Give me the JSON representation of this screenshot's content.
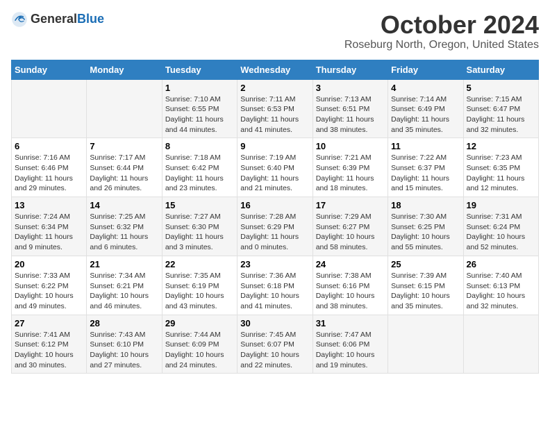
{
  "header": {
    "logo_general": "General",
    "logo_blue": "Blue",
    "month": "October 2024",
    "location": "Roseburg North, Oregon, United States"
  },
  "calendar": {
    "days_of_week": [
      "Sunday",
      "Monday",
      "Tuesday",
      "Wednesday",
      "Thursday",
      "Friday",
      "Saturday"
    ],
    "weeks": [
      [
        {
          "day": "",
          "sunrise": "",
          "sunset": "",
          "daylight": ""
        },
        {
          "day": "",
          "sunrise": "",
          "sunset": "",
          "daylight": ""
        },
        {
          "day": "1",
          "sunrise": "Sunrise: 7:10 AM",
          "sunset": "Sunset: 6:55 PM",
          "daylight": "Daylight: 11 hours and 44 minutes."
        },
        {
          "day": "2",
          "sunrise": "Sunrise: 7:11 AM",
          "sunset": "Sunset: 6:53 PM",
          "daylight": "Daylight: 11 hours and 41 minutes."
        },
        {
          "day": "3",
          "sunrise": "Sunrise: 7:13 AM",
          "sunset": "Sunset: 6:51 PM",
          "daylight": "Daylight: 11 hours and 38 minutes."
        },
        {
          "day": "4",
          "sunrise": "Sunrise: 7:14 AM",
          "sunset": "Sunset: 6:49 PM",
          "daylight": "Daylight: 11 hours and 35 minutes."
        },
        {
          "day": "5",
          "sunrise": "Sunrise: 7:15 AM",
          "sunset": "Sunset: 6:47 PM",
          "daylight": "Daylight: 11 hours and 32 minutes."
        }
      ],
      [
        {
          "day": "6",
          "sunrise": "Sunrise: 7:16 AM",
          "sunset": "Sunset: 6:46 PM",
          "daylight": "Daylight: 11 hours and 29 minutes."
        },
        {
          "day": "7",
          "sunrise": "Sunrise: 7:17 AM",
          "sunset": "Sunset: 6:44 PM",
          "daylight": "Daylight: 11 hours and 26 minutes."
        },
        {
          "day": "8",
          "sunrise": "Sunrise: 7:18 AM",
          "sunset": "Sunset: 6:42 PM",
          "daylight": "Daylight: 11 hours and 23 minutes."
        },
        {
          "day": "9",
          "sunrise": "Sunrise: 7:19 AM",
          "sunset": "Sunset: 6:40 PM",
          "daylight": "Daylight: 11 hours and 21 minutes."
        },
        {
          "day": "10",
          "sunrise": "Sunrise: 7:21 AM",
          "sunset": "Sunset: 6:39 PM",
          "daylight": "Daylight: 11 hours and 18 minutes."
        },
        {
          "day": "11",
          "sunrise": "Sunrise: 7:22 AM",
          "sunset": "Sunset: 6:37 PM",
          "daylight": "Daylight: 11 hours and 15 minutes."
        },
        {
          "day": "12",
          "sunrise": "Sunrise: 7:23 AM",
          "sunset": "Sunset: 6:35 PM",
          "daylight": "Daylight: 11 hours and 12 minutes."
        }
      ],
      [
        {
          "day": "13",
          "sunrise": "Sunrise: 7:24 AM",
          "sunset": "Sunset: 6:34 PM",
          "daylight": "Daylight: 11 hours and 9 minutes."
        },
        {
          "day": "14",
          "sunrise": "Sunrise: 7:25 AM",
          "sunset": "Sunset: 6:32 PM",
          "daylight": "Daylight: 11 hours and 6 minutes."
        },
        {
          "day": "15",
          "sunrise": "Sunrise: 7:27 AM",
          "sunset": "Sunset: 6:30 PM",
          "daylight": "Daylight: 11 hours and 3 minutes."
        },
        {
          "day": "16",
          "sunrise": "Sunrise: 7:28 AM",
          "sunset": "Sunset: 6:29 PM",
          "daylight": "Daylight: 11 hours and 0 minutes."
        },
        {
          "day": "17",
          "sunrise": "Sunrise: 7:29 AM",
          "sunset": "Sunset: 6:27 PM",
          "daylight": "Daylight: 10 hours and 58 minutes."
        },
        {
          "day": "18",
          "sunrise": "Sunrise: 7:30 AM",
          "sunset": "Sunset: 6:25 PM",
          "daylight": "Daylight: 10 hours and 55 minutes."
        },
        {
          "day": "19",
          "sunrise": "Sunrise: 7:31 AM",
          "sunset": "Sunset: 6:24 PM",
          "daylight": "Daylight: 10 hours and 52 minutes."
        }
      ],
      [
        {
          "day": "20",
          "sunrise": "Sunrise: 7:33 AM",
          "sunset": "Sunset: 6:22 PM",
          "daylight": "Daylight: 10 hours and 49 minutes."
        },
        {
          "day": "21",
          "sunrise": "Sunrise: 7:34 AM",
          "sunset": "Sunset: 6:21 PM",
          "daylight": "Daylight: 10 hours and 46 minutes."
        },
        {
          "day": "22",
          "sunrise": "Sunrise: 7:35 AM",
          "sunset": "Sunset: 6:19 PM",
          "daylight": "Daylight: 10 hours and 43 minutes."
        },
        {
          "day": "23",
          "sunrise": "Sunrise: 7:36 AM",
          "sunset": "Sunset: 6:18 PM",
          "daylight": "Daylight: 10 hours and 41 minutes."
        },
        {
          "day": "24",
          "sunrise": "Sunrise: 7:38 AM",
          "sunset": "Sunset: 6:16 PM",
          "daylight": "Daylight: 10 hours and 38 minutes."
        },
        {
          "day": "25",
          "sunrise": "Sunrise: 7:39 AM",
          "sunset": "Sunset: 6:15 PM",
          "daylight": "Daylight: 10 hours and 35 minutes."
        },
        {
          "day": "26",
          "sunrise": "Sunrise: 7:40 AM",
          "sunset": "Sunset: 6:13 PM",
          "daylight": "Daylight: 10 hours and 32 minutes."
        }
      ],
      [
        {
          "day": "27",
          "sunrise": "Sunrise: 7:41 AM",
          "sunset": "Sunset: 6:12 PM",
          "daylight": "Daylight: 10 hours and 30 minutes."
        },
        {
          "day": "28",
          "sunrise": "Sunrise: 7:43 AM",
          "sunset": "Sunset: 6:10 PM",
          "daylight": "Daylight: 10 hours and 27 minutes."
        },
        {
          "day": "29",
          "sunrise": "Sunrise: 7:44 AM",
          "sunset": "Sunset: 6:09 PM",
          "daylight": "Daylight: 10 hours and 24 minutes."
        },
        {
          "day": "30",
          "sunrise": "Sunrise: 7:45 AM",
          "sunset": "Sunset: 6:07 PM",
          "daylight": "Daylight: 10 hours and 22 minutes."
        },
        {
          "day": "31",
          "sunrise": "Sunrise: 7:47 AM",
          "sunset": "Sunset: 6:06 PM",
          "daylight": "Daylight: 10 hours and 19 minutes."
        },
        {
          "day": "",
          "sunrise": "",
          "sunset": "",
          "daylight": ""
        },
        {
          "day": "",
          "sunrise": "",
          "sunset": "",
          "daylight": ""
        }
      ]
    ]
  }
}
